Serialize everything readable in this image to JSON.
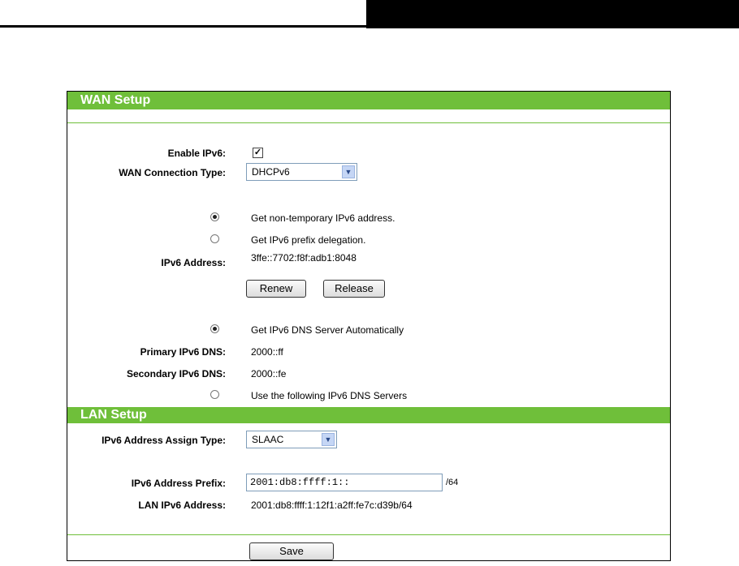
{
  "wan": {
    "title": "WAN Setup",
    "enable_ipv6_label": "Enable IPv6:",
    "enable_ipv6_checked": true,
    "check_mark": "✓",
    "connection_type_label": "WAN Connection Type:",
    "connection_type_value": "DHCPv6",
    "opt_nontemp": "Get non-temporary IPv6 address.",
    "opt_prefix": "Get IPv6 prefix delegation.",
    "ipv6_address_label": "IPv6 Address:",
    "ipv6_address_value": "3ffe::7702:f8f:adb1:8048",
    "renew_label": "Renew",
    "release_label": "Release",
    "dns_auto": "Get IPv6 DNS Server Automatically",
    "primary_dns_label": "Primary IPv6 DNS:",
    "primary_dns_value": "2000::ff",
    "secondary_dns_label": "Secondary IPv6 DNS:",
    "secondary_dns_value": "2000::fe",
    "dns_manual": "Use the following IPv6 DNS Servers"
  },
  "lan": {
    "title": "LAN Setup",
    "assign_type_label": "IPv6 Address Assign Type:",
    "assign_type_value": "SLAAC",
    "prefix_label": "IPv6 Address Prefix:",
    "prefix_value": "2001:db8:ffff:1::",
    "prefix_suffix": "/64",
    "lan_address_label": "LAN IPv6 Address:",
    "lan_address_value": "2001:db8:ffff:1:12f1:a2ff:fe7c:d39b/64"
  },
  "save_label": "Save",
  "icons": {
    "dropdown": "chevron-down-icon"
  },
  "colors": {
    "section_bar": "#6fbf3a"
  }
}
